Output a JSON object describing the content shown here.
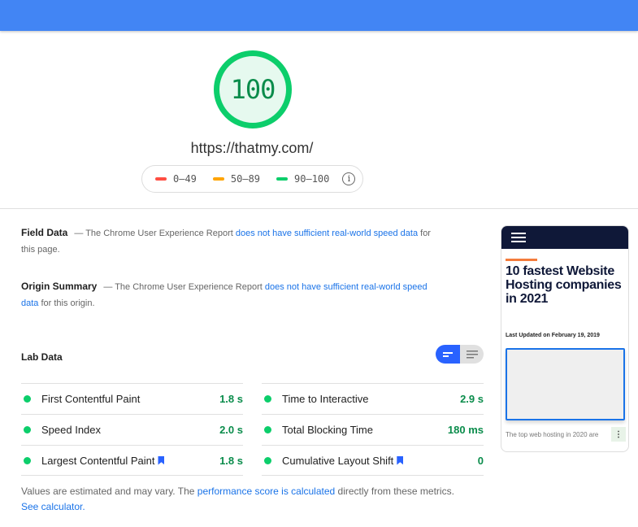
{
  "score": {
    "value": "100",
    "url": "https://thatmy.com/"
  },
  "legend": {
    "items": [
      {
        "range": "0–49",
        "color": "#ff4e42"
      },
      {
        "range": "50–89",
        "color": "#ffa400"
      },
      {
        "range": "90–100",
        "color": "#0cce6b"
      }
    ],
    "info_icon": "i"
  },
  "field_data": {
    "title": "Field Data",
    "prefix": "— The Chrome User Experience Report ",
    "link": "does not have sufficient real-world speed data",
    "suffix": " for this page."
  },
  "origin_summary": {
    "title": "Origin Summary",
    "prefix": "— The Chrome User Experience Report ",
    "link": "does not have sufficient real-world speed data",
    "suffix": " for this origin."
  },
  "lab_data": {
    "title": "Lab Data",
    "metrics": [
      {
        "name": "First Contentful Paint",
        "value": "1.8 s",
        "core": false
      },
      {
        "name": "Time to Interactive",
        "value": "2.9 s",
        "core": false
      },
      {
        "name": "Speed Index",
        "value": "2.0 s",
        "core": false
      },
      {
        "name": "Total Blocking Time",
        "value": "180 ms",
        "core": false
      },
      {
        "name": "Largest Contentful Paint",
        "value": "1.8 s",
        "core": true
      },
      {
        "name": "Cumulative Layout Shift",
        "value": "0",
        "core": true
      }
    ]
  },
  "footnote": {
    "text1": "Values are estimated and may vary. The ",
    "link1": "performance score is calculated",
    "text2": " directly from these metrics. ",
    "link2": "See calculator."
  },
  "screenshot": {
    "title": "10 fastest Website Hosting companies in 2021",
    "date": "Last Updated on February 19, 2019",
    "text": "The top web hosting in 2020 are",
    "menu": "⋮"
  }
}
